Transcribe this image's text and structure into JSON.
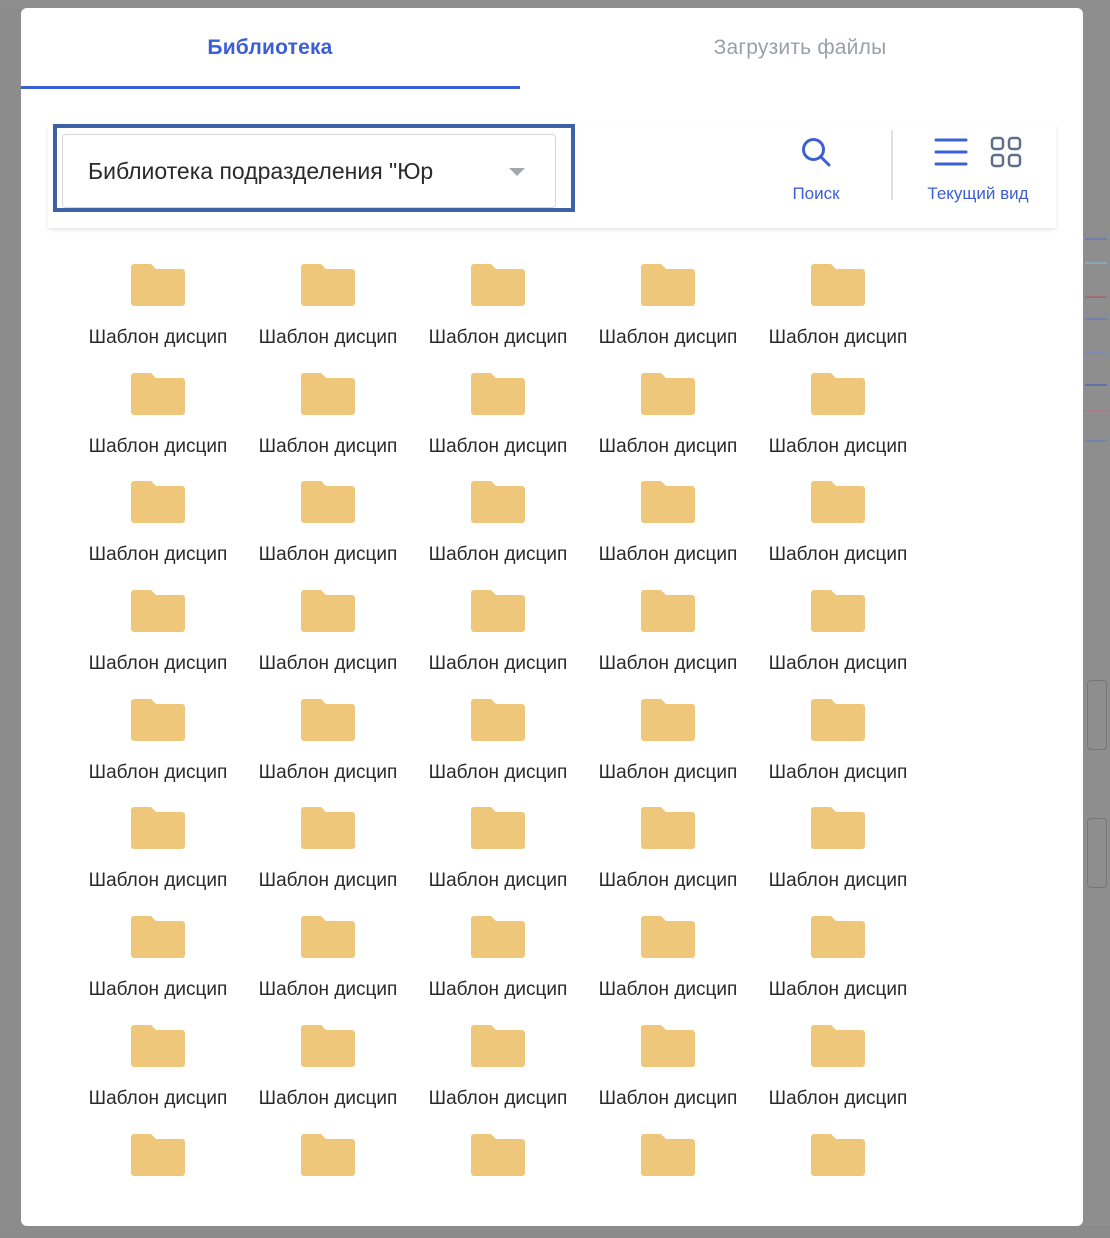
{
  "tabs": [
    {
      "label": "Библиотека",
      "active": true
    },
    {
      "label": "Загрузить файлы",
      "active": false
    }
  ],
  "toolbar": {
    "library_select_value": "Библиотека подразделения \"Юр",
    "search_label": "Поиск",
    "view_label": "Текущий вид"
  },
  "colors": {
    "accent": "#3c5fd6",
    "folder": "#efc77a",
    "highlight_border": "#3d63a6"
  },
  "folders": [
    "Шаблон дисцип",
    "Шаблон дисцип",
    "Шаблон дисцип",
    "Шаблон дисцип",
    "Шаблон дисцип",
    "Шаблон дисцип",
    "Шаблон дисцип",
    "Шаблон дисцип",
    "Шаблон дисцип",
    "Шаблон дисцип",
    "Шаблон дисцип",
    "Шаблон дисцип",
    "Шаблон дисцип",
    "Шаблон дисцип",
    "Шаблон дисцип",
    "Шаблон дисцип",
    "Шаблон дисцип",
    "Шаблон дисцип",
    "Шаблон дисцип",
    "Шаблон дисцип",
    "Шаблон дисцип",
    "Шаблон дисцип",
    "Шаблон дисцип",
    "Шаблон дисцип",
    "Шаблон дисцип",
    "Шаблон дисцип",
    "Шаблон дисцип",
    "Шаблон дисцип",
    "Шаблон дисцип",
    "Шаблон дисцип",
    "Шаблон дисцип",
    "Шаблон дисцип",
    "Шаблон дисцип",
    "Шаблон дисцип",
    "Шаблон дисцип",
    "Шаблон дисцип",
    "Шаблон дисцип",
    "Шаблон дисцип",
    "Шаблон дисцип",
    "Шаблон дисцип",
    "",
    "",
    "",
    "",
    ""
  ]
}
